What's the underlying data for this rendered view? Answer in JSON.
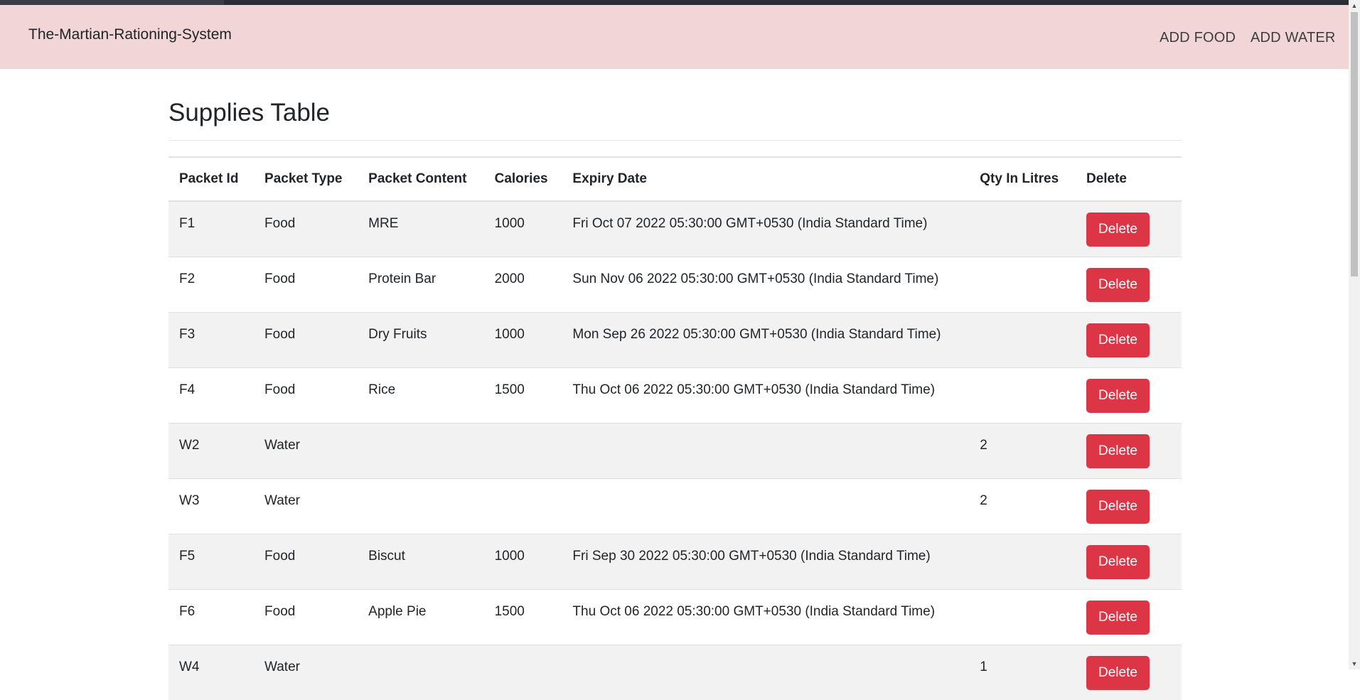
{
  "navbar": {
    "brand": "The-Martian-Rationing-System",
    "links": [
      "ADD FOOD",
      "ADD WATER"
    ],
    "background": "#f2d5d7"
  },
  "main": {
    "title": "Supplies Table",
    "table": {
      "headers": [
        "Packet Id",
        "Packet Type",
        "Packet Content",
        "Calories",
        "Expiry Date",
        "Qty In Litres",
        "Delete"
      ],
      "rows": [
        {
          "id": "F1",
          "type": "Food",
          "content": "MRE",
          "calories": "1000",
          "expiry": "Fri Oct 07 2022 05:30:00 GMT+0530 (India Standard Time)",
          "qty": "",
          "action": "Delete"
        },
        {
          "id": "F2",
          "type": "Food",
          "content": "Protein Bar",
          "calories": "2000",
          "expiry": "Sun Nov 06 2022 05:30:00 GMT+0530 (India Standard Time)",
          "qty": "",
          "action": "Delete"
        },
        {
          "id": "F3",
          "type": "Food",
          "content": "Dry Fruits",
          "calories": "1000",
          "expiry": "Mon Sep 26 2022 05:30:00 GMT+0530 (India Standard Time)",
          "qty": "",
          "action": "Delete"
        },
        {
          "id": "F4",
          "type": "Food",
          "content": "Rice",
          "calories": "1500",
          "expiry": "Thu Oct 06 2022 05:30:00 GMT+0530 (India Standard Time)",
          "qty": "",
          "action": "Delete"
        },
        {
          "id": "W2",
          "type": "Water",
          "content": "",
          "calories": "",
          "expiry": "",
          "qty": "2",
          "action": "Delete"
        },
        {
          "id": "W3",
          "type": "Water",
          "content": "",
          "calories": "",
          "expiry": "",
          "qty": "2",
          "action": "Delete"
        },
        {
          "id": "F5",
          "type": "Food",
          "content": "Biscut",
          "calories": "1000",
          "expiry": "Fri Sep 30 2022 05:30:00 GMT+0530 (India Standard Time)",
          "qty": "",
          "action": "Delete"
        },
        {
          "id": "F6",
          "type": "Food",
          "content": "Apple Pie",
          "calories": "1500",
          "expiry": "Thu Oct 06 2022 05:30:00 GMT+0530 (India Standard Time)",
          "qty": "",
          "action": "Delete"
        },
        {
          "id": "W4",
          "type": "Water",
          "content": "",
          "calories": "",
          "expiry": "",
          "qty": "1",
          "action": "Delete"
        }
      ]
    }
  },
  "colors": {
    "delete_button": "#dc3545",
    "striped_row": "#f2f2f2"
  },
  "icons": {
    "scroll_up": "scroll-up-arrow-icon",
    "scroll_down": "scroll-down-arrow-icon"
  }
}
